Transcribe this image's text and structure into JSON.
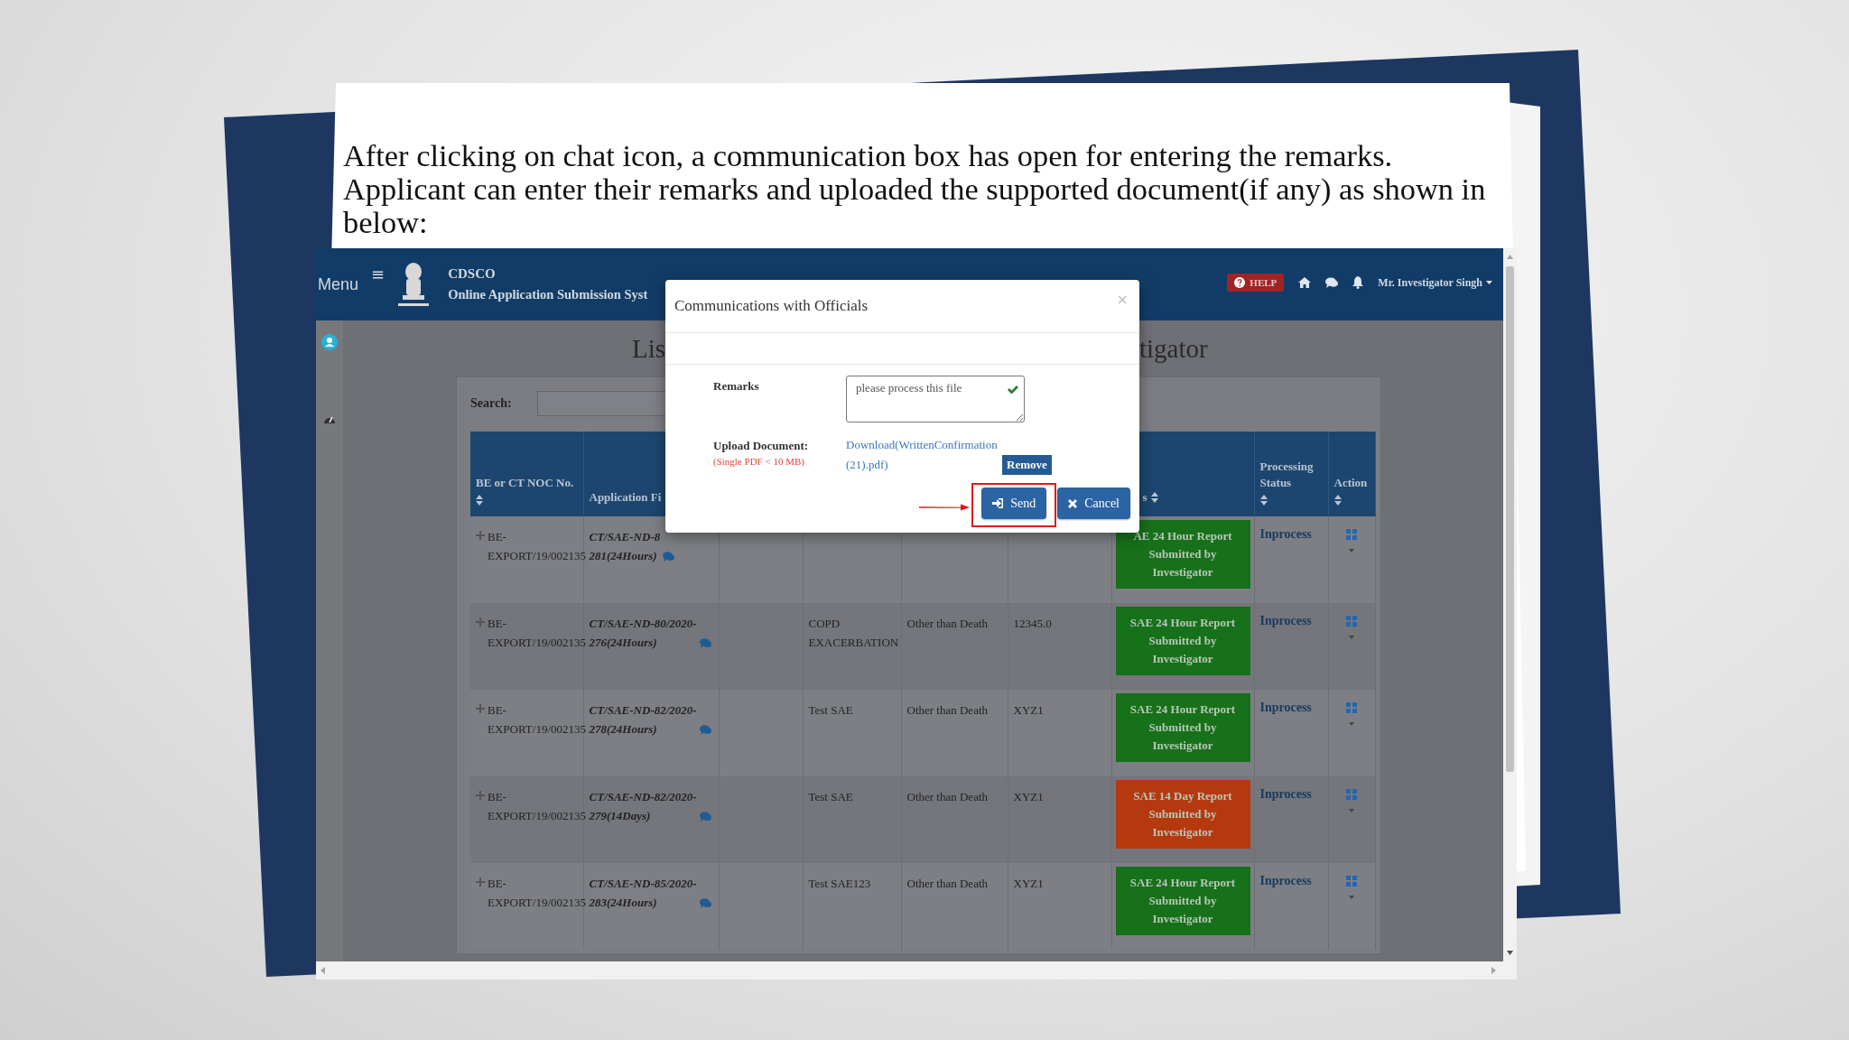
{
  "caption": "After clicking on chat icon, a communication box has open for entering the remarks.\nApplicant can enter their remarks and uploaded the supported document(if any) as shown in below:",
  "app": {
    "header": {
      "menu_label": "Menu",
      "menu_glyph": "≡",
      "brand": "CDSCO",
      "system_name": "Online Application Submission Syst",
      "help": "HELP",
      "user": "Mr. Investigator Singh"
    },
    "page_title_left": "Lis",
    "page_title_right": "tigator",
    "search": {
      "label": "Search:"
    },
    "table": {
      "columns": [
        {
          "label": "BE or CT NOC No.",
          "sortable": true
        },
        {
          "label": "Application Fi",
          "sortable": false
        },
        {},
        {},
        {},
        {},
        {
          "label": "s",
          "sortable": true
        },
        {
          "label": "Processing Status",
          "sortable": true
        },
        {
          "label": "Action",
          "sortable": true
        }
      ],
      "rows": [
        {
          "noc": [
            "BE-",
            "EXPORT/19/002135"
          ],
          "application": [
            "CT/SAE-ND-8",
            "281(24Hours)"
          ],
          "report": {
            "text": "AE 24 Hour Report Submitted by Investigator",
            "color": "#17701a"
          },
          "status": "Inprocess"
        },
        {
          "noc": [
            "BE-",
            "EXPORT/19/002135"
          ],
          "application": [
            "CT/SAE-ND-80/2020-",
            "276(24Hours)"
          ],
          "column_4": "COPD EXACERBATION",
          "column_5": "Other than Death",
          "column_6": "12345.0",
          "report": {
            "text": "SAE 24 Hour Report Submitted by Investigator",
            "color": "#17701a"
          },
          "status": "Inprocess"
        },
        {
          "noc": [
            "BE-",
            "EXPORT/19/002135"
          ],
          "application": [
            "CT/SAE-ND-82/2020-",
            "278(24Hours)"
          ],
          "column_4": "Test SAE",
          "column_5": "Other than Death",
          "column_6": "XYZ1",
          "report": {
            "text": "SAE 24 Hour Report Submitted by Investigator",
            "color": "#17701a"
          },
          "status": "Inprocess"
        },
        {
          "noc": [
            "BE-",
            "EXPORT/19/002135"
          ],
          "application": [
            "CT/SAE-ND-82/2020-",
            "279(14Days)"
          ],
          "column_4": "Test SAE",
          "column_5": "Other than Death",
          "column_6": "XYZ1",
          "report": {
            "text": "SAE 14 Day Report Submitted by Investigator",
            "color": "#b5380f"
          },
          "status": "Inprocess"
        },
        {
          "noc": [
            "BE-",
            "EXPORT/19/002135"
          ],
          "application": [
            "CT/SAE-ND-85/2020-",
            "283(24Hours)"
          ],
          "column_4": "Test SAE123",
          "column_5": "Other than Death",
          "column_6": "XYZ1",
          "report": {
            "text": "SAE 24 Hour Report Submitted by Investigator",
            "color": "#17701a"
          },
          "status": "Inprocess"
        }
      ]
    }
  },
  "dialog": {
    "title": "Communications with Officials",
    "close": "×",
    "remarks": {
      "label": "Remarks",
      "value": "please process this file",
      "valid": true
    },
    "upload": {
      "label": "Upload Document:",
      "hint": "(Single PDF < 10 MB)",
      "file_link": "Download(WrittenConfirmation (21).pdf)",
      "remove": "Remove"
    },
    "buttons": [
      {
        "label": "Send",
        "kind": "send",
        "highlighted": true
      },
      {
        "label": "Cancel",
        "kind": "cancel",
        "highlighted": false
      }
    ]
  }
}
